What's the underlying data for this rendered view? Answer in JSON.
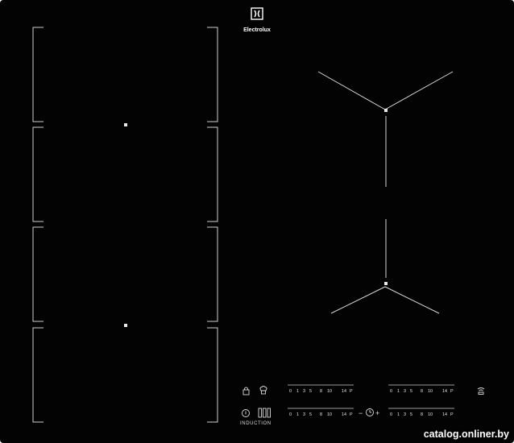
{
  "brand": {
    "name": "Electrolux"
  },
  "panel": {
    "induction_label": "INDUCTION"
  },
  "scales": {
    "numbers": [
      "0",
      "1",
      "3",
      "5",
      "8",
      "10",
      "14",
      "P"
    ]
  },
  "timer": {
    "minus": "−",
    "plus": "+"
  },
  "watermark": {
    "text": "catalog.onliner.by"
  },
  "colors": {
    "glass": "#030303",
    "markings": "#dcdcdc"
  },
  "icons": [
    "electrolux-logo-icon",
    "lock-icon",
    "chef-hat-icon",
    "bridge-icon",
    "power-icon",
    "timer-icon",
    "hob2hood-icon"
  ]
}
